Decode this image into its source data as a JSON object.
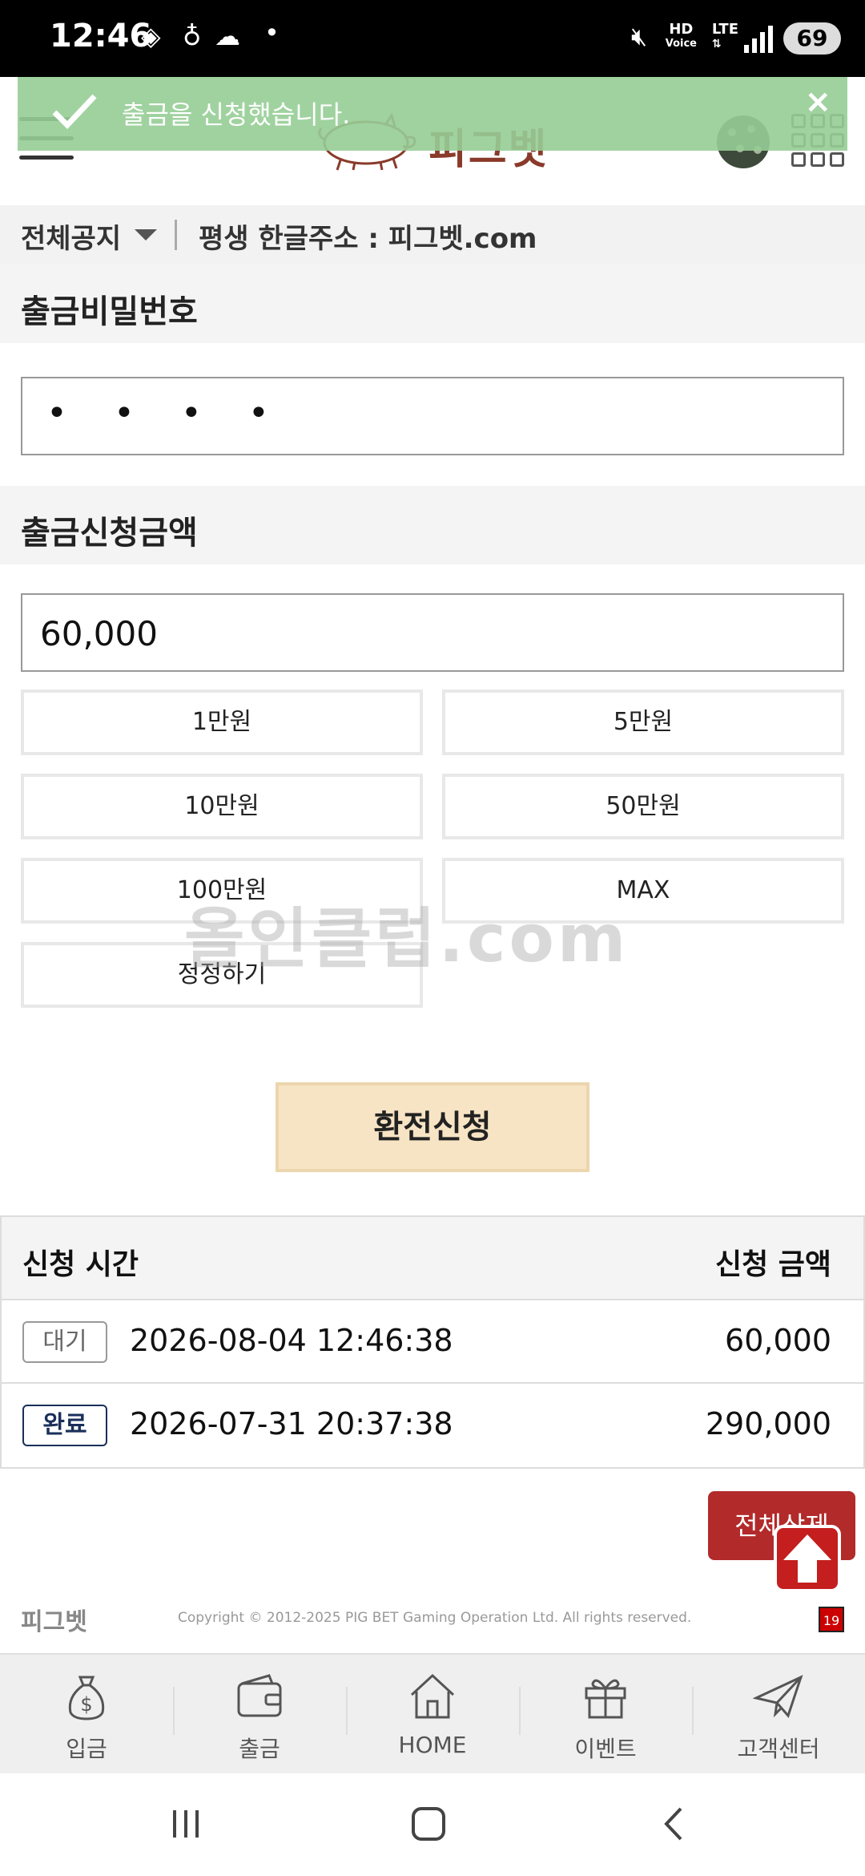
{
  "status": {
    "time": "12:46",
    "battery": "69",
    "hd": "HD",
    "voice": "Voice",
    "lte": "LTE"
  },
  "toast": {
    "message": "출금을 신청했습니다.",
    "close": "×"
  },
  "header": {
    "logo_text": "피그벳"
  },
  "notice": {
    "title": "전체공지",
    "address": "평생 한글주소 : 피그벳.com"
  },
  "withdraw": {
    "password_label": "출금비밀번호",
    "password_value": "• • • •",
    "amount_label": "출금신청금액",
    "amount_value": "60,000",
    "quick_buttons": [
      "1만원",
      "5만원",
      "10만원",
      "50만원",
      "100만원",
      "MAX",
      "정정하기"
    ],
    "submit": "환전신청"
  },
  "watermark": "올인클럽.com",
  "history": {
    "col_time": "신청 시간",
    "col_amount": "신청 금액",
    "rows": [
      {
        "status": "대기",
        "time": "2026-08-04 12:46:38",
        "amount": "60,000"
      },
      {
        "status": "완료",
        "time": "2026-07-31 20:37:38",
        "amount": "290,000"
      }
    ],
    "delete_all": "전체삭제"
  },
  "footer": {
    "logo": "피그벳",
    "copyright": "Copyright © 2012-2025 PIG BET Gaming Operation Ltd. All rights reserved.",
    "age_badge": "19"
  },
  "bottom_nav": [
    "입금",
    "출금",
    "HOME",
    "이벤트",
    "고객센터"
  ],
  "colors": {
    "toast": "#96cd96",
    "submit": "#f7e4c4",
    "delete": "#b22a2a",
    "badge_done": "#1a2f5a"
  }
}
